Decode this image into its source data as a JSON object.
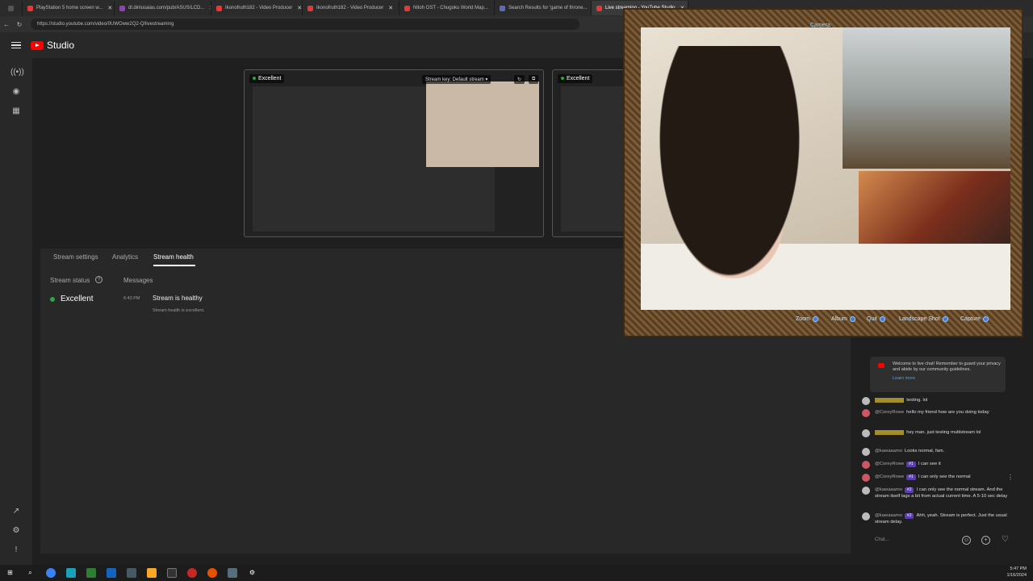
{
  "browser": {
    "tabs": [
      {
        "label": "PlayStation 5 home screen w...",
        "color": "#e53935"
      },
      {
        "label": "dl.dinlusaias.com/pub/ASUS/LCD...",
        "color": "#8e44ad"
      },
      {
        "label": "Ikonofruth182 - Video Producer",
        "color": "#e53935"
      },
      {
        "label": "Ikonofruth182 - Video Producer",
        "color": "#e53935"
      },
      {
        "label": "Nitoh OST - Chugoku World Map...",
        "color": "#e53935"
      },
      {
        "label": "Search Results for 'game of throne...",
        "color": "#5c6bc0"
      },
      {
        "label": "Live streaming - YouTube Studio",
        "color": "#e53935"
      }
    ],
    "url": "https://studio.youtube.com/video/0UWOww2Q2-Q/livestreaming"
  },
  "header": {
    "app_name": "Studio"
  },
  "preview": {
    "status_label": "Excellent",
    "stream_key_label": "Stream key: Default stream",
    "status_label_2": "Excellent"
  },
  "panel": {
    "tabs": [
      "Stream settings",
      "Analytics",
      "Stream health"
    ],
    "stream_status_label": "Stream status",
    "messages_label": "Messages",
    "status_value": "Excellent",
    "message_time": "6:43 PM",
    "message_title": "Stream is healthy",
    "message_detail": "Stream health is excellent."
  },
  "camera": {
    "label": "Camera",
    "controls": [
      "Zoom",
      "Album",
      "Quit",
      "Landscape Shot",
      "Capture"
    ]
  },
  "chat": {
    "welcome": "Welcome to live chat! Remember to guard your privacy and abide by our community guidelines.",
    "learn_more": "Learn more",
    "messages": [
      {
        "author": "",
        "badge": "",
        "text": "testing. lol"
      },
      {
        "author": "@CoreyRowe",
        "badge": "",
        "text": "hello my friend how are you doing today"
      },
      {
        "author": "",
        "badge": "",
        "text": "hey man. just testing multistream lol"
      },
      {
        "author": "@kawaaamo",
        "badge": "",
        "text": "Looks normal, fam."
      },
      {
        "author": "@CoreyRowe",
        "badge": "#1",
        "text": "I can see it"
      },
      {
        "author": "@CoreyRowe",
        "badge": "#1",
        "text": "I can only see the normal"
      },
      {
        "author": "@kawaaamo",
        "badge": "#2",
        "text": "I can only see the normal stream. And the stream itself lags a bit from actual current time. A 5-10 sec delay"
      },
      {
        "author": "@kawaaamo",
        "badge": "#2",
        "text": "Ahh, yeah. Stream is perfect. Just the usual stream delay."
      }
    ],
    "input_placeholder": "Chat..."
  },
  "taskbar": {
    "time": "5:47 PM",
    "date": "1/16/2024"
  }
}
